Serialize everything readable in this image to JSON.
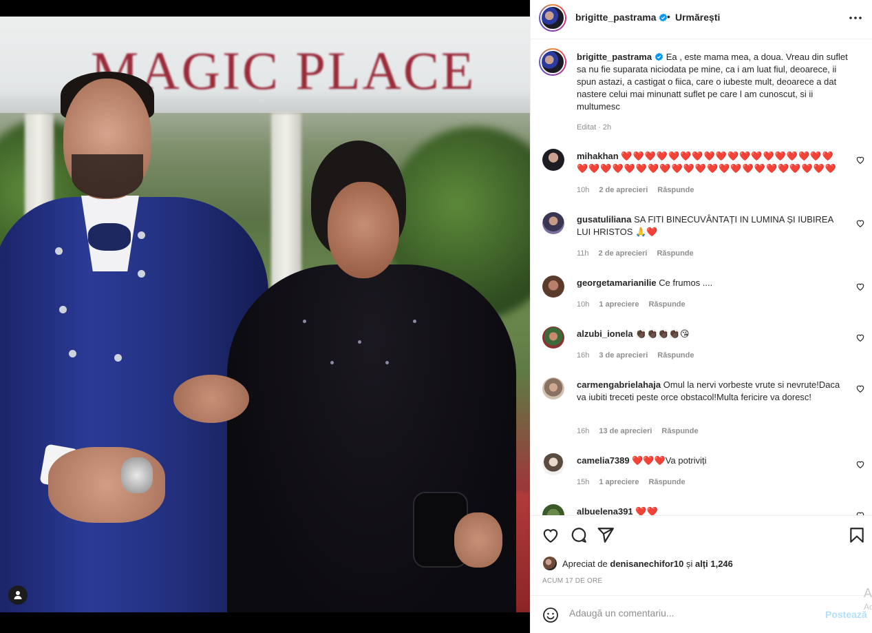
{
  "post": {
    "username": "brigitte_pastrama",
    "follow_label": "Urmărești",
    "separator": "•",
    "caption": "Ea , este mama mea, a doua. Vreau din suflet sa nu fie suparata niciodata pe mine, ca i am luat fiul, deoarece, ii spun astazi, a castigat o fiica, care o iubeste mult, deoarece a dat nastere celui mai minunatt suflet pe care l am cunoscut, si ii multumesc",
    "caption_meta": "Editat · 2h",
    "photo_sign_text": "MAGIC PLACE"
  },
  "comments": [
    {
      "user": "mihakhan",
      "text": "❤️❤️❤️❤️❤️❤️❤️❤️❤️❤️❤️❤️❤️❤️❤️❤️❤️❤️❤️❤️❤️❤️❤️❤️❤️❤️❤️❤️❤️❤️❤️❤️❤️❤️❤️❤️❤️❤️❤️❤️",
      "time": "10h",
      "likes": "2 de aprecieri",
      "reply": "Răspunde"
    },
    {
      "user": "gusatuliliana",
      "text": "SA FITI BINECUVÂNTAȚI IN LUMINA ȘI IUBIREA LUI HRISTOS 🙏❤️",
      "time": "11h",
      "likes": "2 de aprecieri",
      "reply": "Răspunde"
    },
    {
      "user": "georgetamarianilie",
      "text": "Ce frumos ....",
      "time": "10h",
      "likes": "1 apreciere",
      "reply": "Răspunde"
    },
    {
      "user": "alzubi_ionela",
      "text": "👏🏿👏🏿👏🏿👏🏿😘",
      "time": "16h",
      "likes": "3 de aprecieri",
      "reply": "Răspunde"
    },
    {
      "user": "carmengabrielahaja",
      "text": "Omul la nervi vorbeste vrute si nevrute!Daca va iubiti treceti peste orce obstacol!Multa fericire va doresc!",
      "time": "16h",
      "likes": "13 de aprecieri",
      "reply": "Răspunde"
    },
    {
      "user": "camelia7389",
      "text": "❤️❤️❤️Va potriviți",
      "time": "15h",
      "likes": "1 apreciere",
      "reply": "Răspunde"
    },
    {
      "user": "albuelena391",
      "text": "❤️❤️",
      "time": "",
      "likes": "",
      "reply": ""
    }
  ],
  "footer": {
    "liked_prefix": "Apreciat de",
    "liked_user": "denisanechifor10",
    "liked_mid": "și",
    "liked_others": "alți 1,246",
    "time_ago": "ACUM 17 DE ORE",
    "add_placeholder": "Adaugă un comentariu...",
    "post_label": "Postează"
  },
  "overlay": {
    "activate_a": "A",
    "activate_b": "Ac"
  },
  "icons": {
    "like": "heart-icon",
    "comment": "comment-icon",
    "share": "share-icon",
    "save": "bookmark-icon",
    "more": "more-options-icon",
    "emoji": "emoji-icon",
    "tag": "user-tag-icon",
    "verified": "verified-badge-icon"
  },
  "colors": {
    "accent_red": "#e0245e",
    "verified_blue": "#0095f6",
    "post_button": "#b2dffc"
  }
}
